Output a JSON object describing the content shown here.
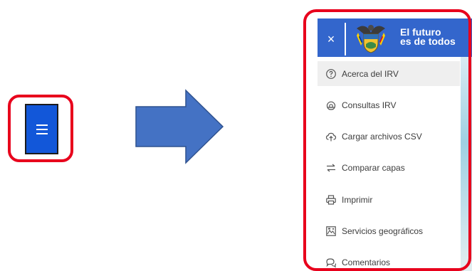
{
  "left_button": {
    "icon": "hamburger-menu-icon",
    "color": "#1257d9"
  },
  "highlight_color": "#e8001c",
  "arrow": {
    "icon": "right-arrow",
    "color": "#4472c4"
  },
  "panel": {
    "header": {
      "background": "#3366cc",
      "close_label": "×",
      "crest_icon": "coat-of-arms-icon",
      "slogan_line1": "El futuro",
      "slogan_line2": "es de todos"
    },
    "menu_items": [
      {
        "label": "Acerca del IRV",
        "icon": "help-circle-icon",
        "active": true
      },
      {
        "label": "Consultas IRV",
        "icon": "query-icon",
        "active": false
      },
      {
        "label": "Cargar archivos CSV",
        "icon": "cloud-upload-icon",
        "active": false
      },
      {
        "label": "Comparar capas",
        "icon": "swap-arrows-icon",
        "active": false
      },
      {
        "label": "Imprimir",
        "icon": "printer-icon",
        "active": false
      },
      {
        "label": "Servicios geográficos",
        "icon": "geo-services-icon",
        "active": false
      },
      {
        "label": "Comentarios",
        "icon": "comments-icon",
        "active": false
      }
    ]
  }
}
